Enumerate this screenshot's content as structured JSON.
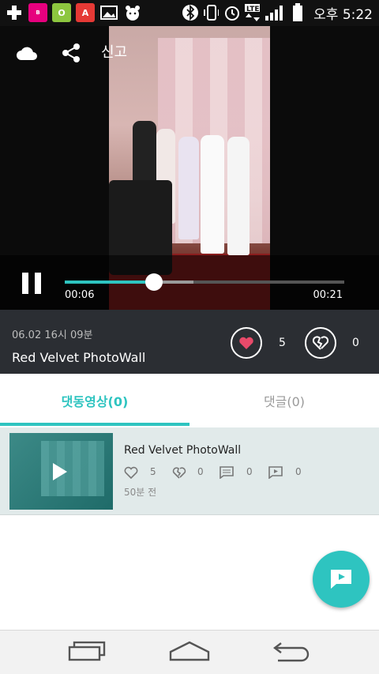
{
  "status_bar": {
    "app_icons": [
      "plus-icon",
      "beauty-app-icon",
      "olive-app-icon",
      "a-app-icon",
      "image-icon",
      "bear-icon"
    ],
    "right_icons": [
      "bluetooth-icon",
      "vibrate-icon",
      "alarm-icon",
      "lte-icon",
      "signal-icon",
      "battery-icon"
    ],
    "time": "오후 5:22"
  },
  "player": {
    "report_label": "신고",
    "current_time": "00:06",
    "total_time": "00:21",
    "progress_fraction": 0.32,
    "buffer_fraction": 0.46,
    "accent": "#2ec4c0"
  },
  "video_info": {
    "date": "06.02 16시 09분",
    "title": "Red Velvet PhotoWall",
    "likes": "5",
    "dislikes": "0",
    "like_color": "#e84a6a"
  },
  "tabs": [
    {
      "label": "댓동영상(0)",
      "active": true
    },
    {
      "label": "댓글(0)",
      "active": false
    }
  ],
  "list": [
    {
      "title": "Red Velvet PhotoWall",
      "likes": "5",
      "dislikes": "0",
      "comments": "0",
      "replies": "0",
      "time_ago": "50분 전"
    }
  ]
}
